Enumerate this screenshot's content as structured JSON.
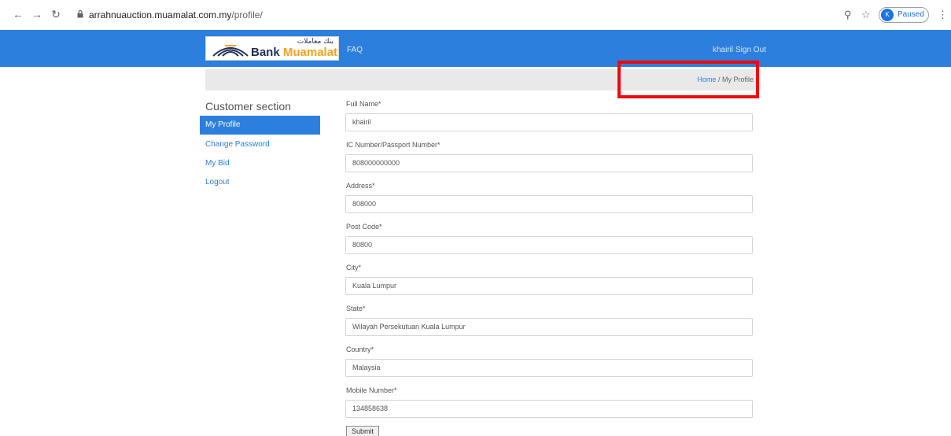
{
  "browser": {
    "url_host": "arrahnuauction.muamalat.com.my",
    "url_path": "/profile/",
    "profile_initial": "K",
    "profile_status": "Paused"
  },
  "header": {
    "logo_text_bank": "Bank ",
    "logo_text_brand": "Muamalat",
    "logo_arabic": "بنك معاملات",
    "faq": "FAQ",
    "user": "khairil",
    "sign_out": "Sign Out",
    "brand_color": "#2d7fde"
  },
  "breadcrumb": {
    "home": "Home",
    "separator": "/",
    "current": "My Profile"
  },
  "sidebar": {
    "title": "Customer section",
    "items": [
      {
        "label": "My Profile"
      },
      {
        "label": "Change Password"
      },
      {
        "label": "My Bid"
      },
      {
        "label": "Logout"
      }
    ]
  },
  "form": {
    "fields": [
      {
        "label": "Full Name*",
        "value": "khairil"
      },
      {
        "label": "IC Number/Passport Number*",
        "value": "808000000000"
      },
      {
        "label": "Address*",
        "value": "808000"
      },
      {
        "label": "Post Code*",
        "value": "80800"
      },
      {
        "label": "City*",
        "value": "Kuala Lumpur"
      },
      {
        "label": "State*",
        "value": "Wilayah Persekutuan Kuala Lumpur"
      },
      {
        "label": "Country*",
        "value": "Malaysia"
      },
      {
        "label": "Mobile Number*",
        "value": "134858638"
      }
    ],
    "submit": "Submit"
  }
}
